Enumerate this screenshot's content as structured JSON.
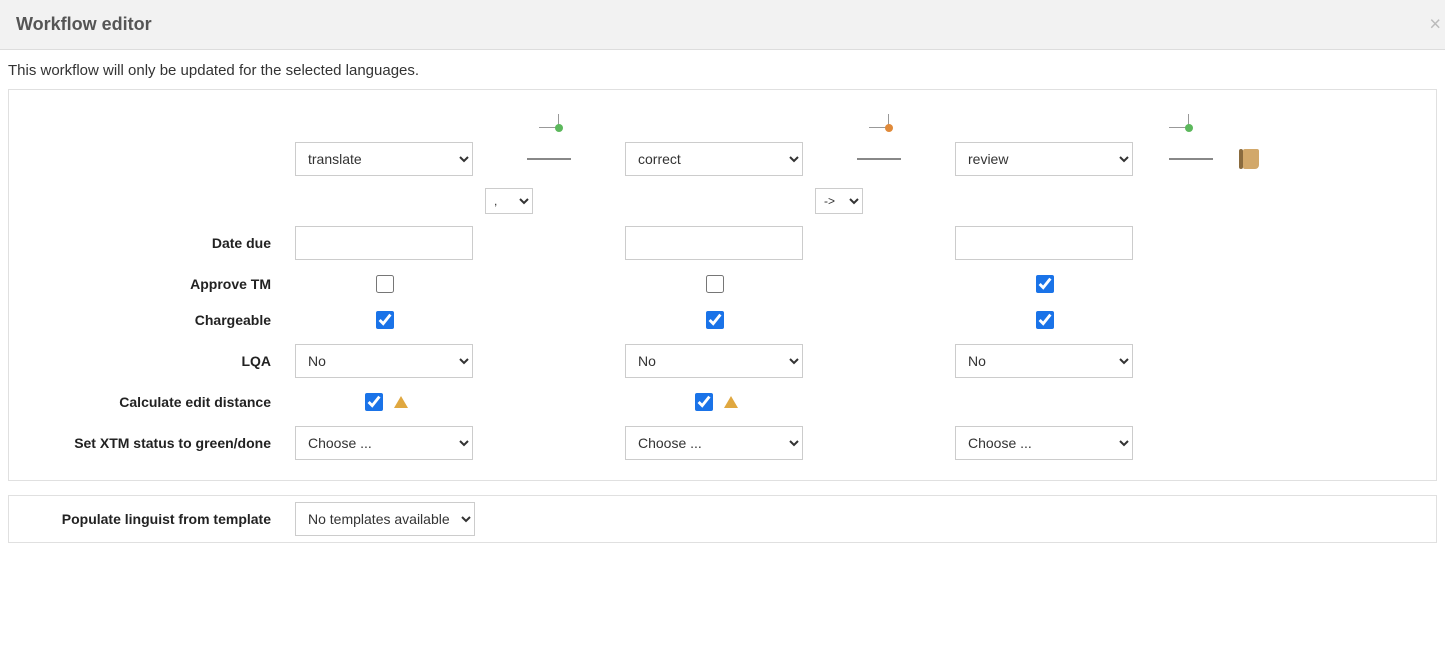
{
  "header": {
    "title": "Workflow editor"
  },
  "subhead": "This workflow will only be updated for the selected languages.",
  "steps": {
    "translate": "translate",
    "correct": "correct",
    "review": "review"
  },
  "connectors": {
    "comma": ",",
    "arrow": "->"
  },
  "rows": {
    "date_due": "Date due",
    "approve_tm": "Approve TM",
    "chargeable": "Chargeable",
    "lqa": "LQA",
    "calc_edit": "Calculate edit distance",
    "set_status": "Set XTM status to green/done",
    "populate": "Populate linguist from template"
  },
  "values": {
    "lqa_no": "No",
    "status_choose": "Choose ...",
    "no_templates": "No templates available"
  },
  "checkboxes": {
    "approve_tm": {
      "c1": false,
      "c2": false,
      "c3": true
    },
    "chargeable": {
      "c1": true,
      "c2": true,
      "c3": true
    },
    "calc_edit": {
      "c1": true,
      "c2": true,
      "c3": false
    }
  },
  "status_dots": [
    "green",
    "orange",
    "green",
    "orange",
    "green"
  ]
}
